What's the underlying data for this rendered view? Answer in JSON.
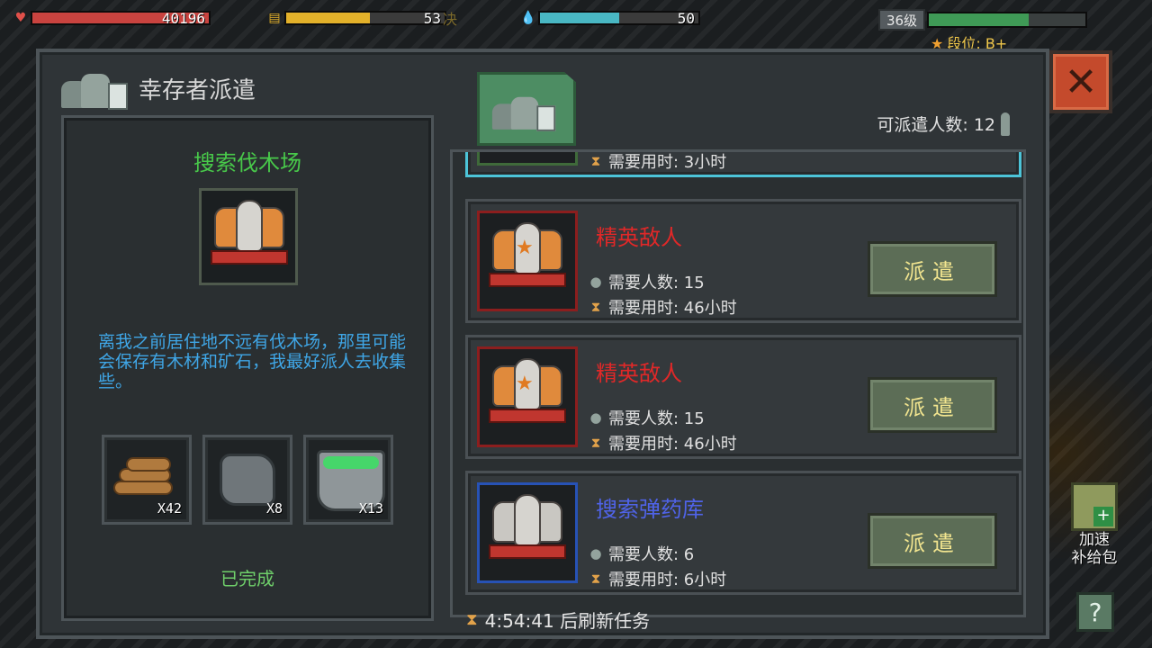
{
  "hud": {
    "hp": {
      "value": "40196",
      "fill": 1.0
    },
    "food": {
      "value": "53",
      "fill": 0.53,
      "extra": "决"
    },
    "water": {
      "value": "50",
      "fill": 0.5
    },
    "level": "36级",
    "xp_fill": 0.64,
    "rank": "段位: B+"
  },
  "panel": {
    "title": "幸存者派遣",
    "dispatch_count_label": "可派遣人数: 12"
  },
  "detail": {
    "title": "搜索伐木场",
    "description": "离我之前居住地不远有伐木场，那里可能会保存有木材和矿石，我最好派人去收集些。",
    "rewards": [
      {
        "icon": "wood-icon",
        "qty": "X42"
      },
      {
        "icon": "stone-icon",
        "qty": "X8"
      },
      {
        "icon": "bucket-icon",
        "qty": "X13"
      }
    ],
    "status": "已完成"
  },
  "missions": [
    {
      "name": "",
      "people": "",
      "time": "需要用时: 3小时"
    },
    {
      "name": "精英敌人",
      "people": "需要人数: 15",
      "time": "需要用时: 46小时",
      "button": "派遣"
    },
    {
      "name": "精英敌人",
      "people": "需要人数: 15",
      "time": "需要用时: 46小时",
      "button": "派遣"
    },
    {
      "name": "搜索弹药库",
      "people": "需要人数: 6",
      "time": "需要用时: 6小时",
      "button": "派遣"
    }
  ],
  "refresh": "4:54:41 后刷新任务",
  "side": {
    "supply_label_1": "加速",
    "supply_label_2": "补给包",
    "help": "?",
    "close": "✕"
  },
  "colors": {
    "elite": "#e02828",
    "search_blue": "#4f63e8",
    "detail_title": "#48c94a",
    "desc": "#3fa6e6",
    "button_text": "#f2e58f"
  }
}
